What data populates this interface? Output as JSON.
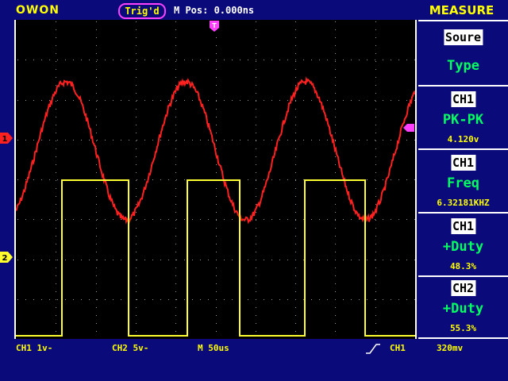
{
  "header": {
    "brand": "OWON",
    "trigger_status": "Trig'd",
    "m_pos": "M Pos: 0.000ns",
    "panel_title": "MEASURE"
  },
  "panel": {
    "source_label": "Soure",
    "type_label": "Type",
    "measurements": [
      {
        "channel": "CH1",
        "name": "PK-PK",
        "value": "4.120v"
      },
      {
        "channel": "CH1",
        "name": "Freq",
        "value": "6.32181KHZ"
      },
      {
        "channel": "CH1",
        "name": "+Duty",
        "value": "48.3%"
      },
      {
        "channel": "CH2",
        "name": "+Duty",
        "value": "55.3%"
      }
    ]
  },
  "markers": {
    "ch1": "1",
    "ch2": "2",
    "trigger": "T"
  },
  "status_bar": {
    "ch1_scale": "CH1  1v-",
    "ch2_scale": "CH2  5v-",
    "timebase": "M 50us",
    "trigger_source": "CH1",
    "trigger_level": "320mv"
  },
  "colors": {
    "background": "#0a0a7a",
    "screen": "#000000",
    "ch1_trace": "#ff2020",
    "ch2_trace": "#ffff30",
    "grid": "#aaaaaa",
    "text_accent": "#ffff00",
    "measure_text": "#00ff60",
    "marker_magenta": "#ff40ff"
  }
}
